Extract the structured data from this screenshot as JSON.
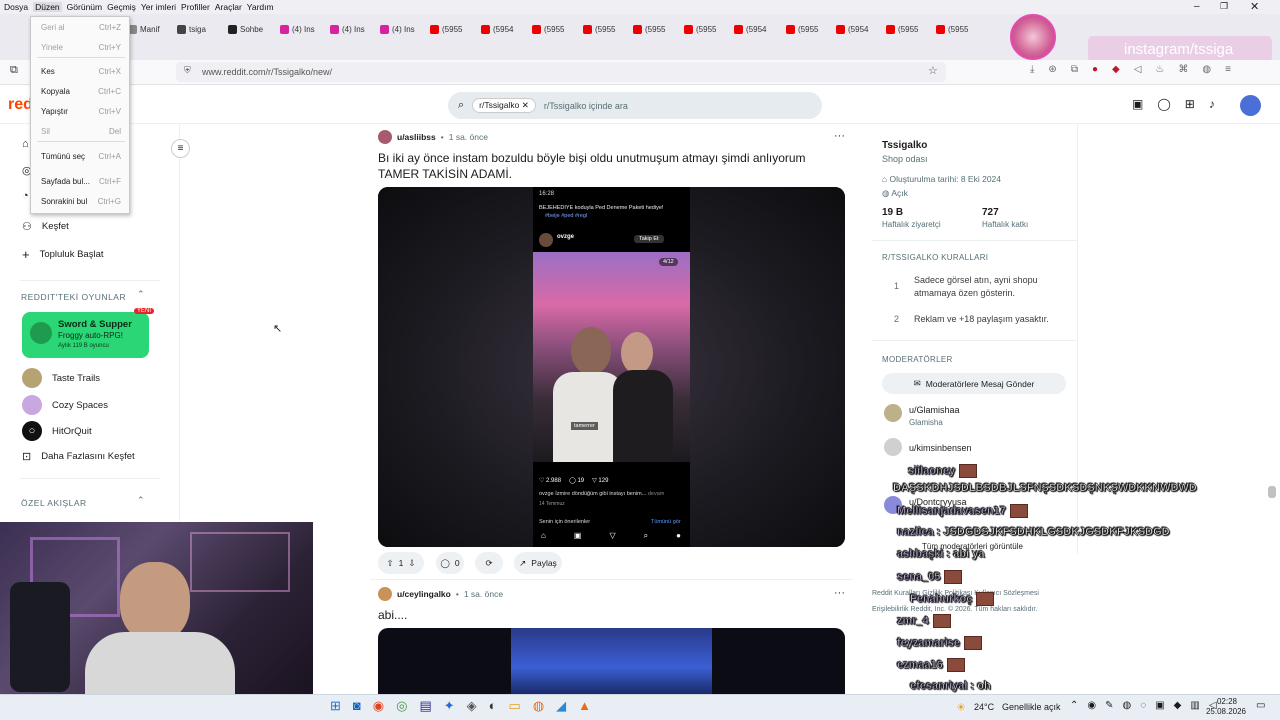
{
  "menubar": [
    "Dosya",
    "Düzen",
    "Görünüm",
    "Geçmiş",
    "Yer imleri",
    "Profiller",
    "Araçlar",
    "Yardım"
  ],
  "tabs": [
    {
      "label": "Manif",
      "color": "#888"
    },
    {
      "label": "tsiga",
      "color": "#444"
    },
    {
      "label": "Sohbe",
      "color": "#222"
    },
    {
      "label": "(4) Ins",
      "color": "#d6249f"
    },
    {
      "label": "(4) Ins",
      "color": "#d6249f"
    },
    {
      "label": "(4) Ins",
      "color": "#d6249f"
    },
    {
      "label": "(5955",
      "color": "#e00"
    },
    {
      "label": "(5954",
      "color": "#e00"
    },
    {
      "label": "(5955",
      "color": "#e00"
    },
    {
      "label": "(5955",
      "color": "#e00"
    },
    {
      "label": "(5955",
      "color": "#e00"
    },
    {
      "label": "(5955",
      "color": "#e00"
    },
    {
      "label": "(5954",
      "color": "#e00"
    },
    {
      "label": "(5955",
      "color": "#e00"
    },
    {
      "label": "(5954",
      "color": "#e00"
    },
    {
      "label": "(5955",
      "color": "#e00"
    },
    {
      "label": "(5955",
      "color": "#e00"
    }
  ],
  "overlay_text": "instagram/tssiga",
  "url": "www.reddit.com/r/Tssigalko/new/",
  "search": {
    "chip": "r/Tssigalko",
    "placeholder": "r/Tssigalko içinde ara"
  },
  "edit_menu": [
    {
      "label": "Geri al",
      "key": "Ctrl+Z",
      "disabled": true
    },
    {
      "label": "Yinele",
      "key": "Ctrl+Y",
      "disabled": true
    },
    {
      "label": "Kes",
      "key": "Ctrl+X",
      "disabled": false
    },
    {
      "label": "Kopyala",
      "key": "Ctrl+C",
      "disabled": false
    },
    {
      "label": "Yapıştır",
      "key": "Ctrl+V",
      "disabled": false
    },
    {
      "label": "Sil",
      "key": "Del",
      "disabled": true
    },
    {
      "label": "Tümünü seç",
      "key": "Ctrl+A",
      "disabled": false
    },
    {
      "label": "Sayfada bul...",
      "key": "Ctrl+F",
      "disabled": false
    },
    {
      "label": "Sonrakini bul",
      "key": "Ctrl+G",
      "disabled": false
    }
  ],
  "sidebar": {
    "kesfet": "Keşfet",
    "topluluk": "Topluluk Başlat",
    "games_head": "REDDIT'TEKİ OYUNLAR",
    "featured": {
      "title": "Sword & Supper",
      "sub": "Froggy auto-RPG!",
      "meta": "Aylık 119 B oyuncu",
      "badge": "YENİ"
    },
    "games": [
      "Taste Trails",
      "Cozy Spaces",
      "HitOrQuit",
      "Daha Fazlasını Keşfet"
    ],
    "feeds_head": "ÖZEL AKIŞLAR"
  },
  "post1": {
    "user": "u/asliibss",
    "time": "1 sa. önce",
    "title": "Bı iki ay önce instam bozuldu böyle bişi oldu unutmuşum atmayı şimdi anlıyorum TAMER TAKİSİN ADAMİ.",
    "votes": "1",
    "comments": "0",
    "share": "Paylaş",
    "phone": {
      "time": "16:28",
      "banner": "BEJEHEDIYE koduyla Ped Deneme Paketi hediye!",
      "tags": "#beije #ped #regl",
      "user": "ovzge",
      "follow": "Takip Et",
      "counter": "4/12",
      "caption": "tamerrer",
      "likes": "2.988",
      "comments": "19",
      "shares": "129",
      "desc": "ovzge İzmire döndüğüm gibi instayı benim...",
      "more": "devam",
      "date": "14 Temmuz",
      "suggest": "Senin için önerilenler",
      "seeall": "Tümünü gör"
    }
  },
  "post2": {
    "user": "u/ceylingalko",
    "time": "1 sa. önce",
    "title": "abi...."
  },
  "rightbar": {
    "name": "Tssigalko",
    "desc": "Shop odası",
    "created": "Oluşturulma tarihi: 8 Eki 2024",
    "status": "Açık",
    "stat1": {
      "value": "19 B",
      "label": "Haftalık ziyaretçi"
    },
    "stat2": {
      "value": "727",
      "label": "Haftalık katkı"
    },
    "rules_head": "R/TSSIGALKO KURALLARI",
    "rules": [
      {
        "n": "1",
        "text": "Sadece görsel atın, ayni shopu atmamaya özen gösterin."
      },
      {
        "n": "2",
        "text": "Reklam ve +18 paylaşım yasaktır."
      }
    ],
    "mods_head": "MODERATÖRLER",
    "msg_btn": "Moderatörlere Mesaj Gönder",
    "mods": [
      {
        "name": "u/Glamishaa",
        "sub": "Glamisha"
      },
      {
        "name": "u/kimsinbensen",
        "sub": ""
      },
      {
        "name": "u/Dontcryyusa",
        "sub": ""
      }
    ],
    "all_mods": "Tüm moderatörleri görüntüle",
    "footer1": "Reddit Kuralları  Gizlilik Politikası  Kullanıcı Sözleşmesi",
    "footer2": "Erişilebilirlik  Reddit, Inc. © 2026. Tüm hakları saklıdır."
  },
  "chat": [
    {
      "user": "siilaoney",
      "msg": ""
    },
    {
      "user": "",
      "msg": "DAŞSKDHJSDLBSDBJLSFNŞSDKSDŞNKŞWDKKNWDWD"
    },
    {
      "user": "Mellisanjadavasen17",
      "msg": ""
    },
    {
      "user": "nazliea",
      "msg": "JSDGDSJKFSDHKLGSDKJGSDKFJKSDGD"
    },
    {
      "user": "aslıbaşki",
      "msg": "abi ya"
    },
    {
      "user": "sena_05",
      "msg": ""
    },
    {
      "user": "Fenahurkoç",
      "msg": ""
    },
    {
      "user": "zmr_4",
      "msg": ""
    },
    {
      "user": "feyzamarise",
      "msg": ""
    },
    {
      "user": "ezmaa16",
      "msg": ""
    },
    {
      "user": "efesanriyal",
      "msg": "oh"
    }
  ],
  "taskbar": {
    "weather": "24°C",
    "weather_text": "Genellikle açık",
    "time": "02:28",
    "date": "25.08.2026"
  }
}
